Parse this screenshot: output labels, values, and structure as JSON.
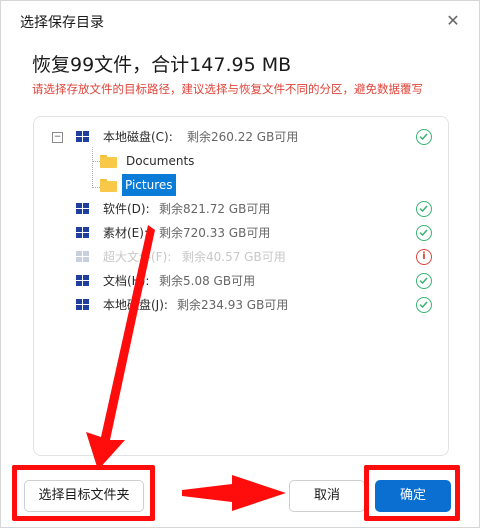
{
  "dialog": {
    "title": "选择保存目录",
    "headline": "恢复99文件，合计147.95 MB",
    "warning": "请选择存放文件的目标路径，建议选择与恢复文件不同的分区，避免数据覆写"
  },
  "tree": {
    "drives": [
      {
        "name": "本地磁盘(C):",
        "space": "剩余260.22 GB可用",
        "status": "ok",
        "expanded": true,
        "children": [
          {
            "name": "Documents"
          },
          {
            "name": "Pictures",
            "selected": true
          }
        ]
      },
      {
        "name": "软件(D):",
        "space": "剩余821.72 GB可用",
        "status": "ok"
      },
      {
        "name": "素材(E):",
        "space": "剩余720.33 GB可用",
        "status": "ok"
      },
      {
        "name": "超大文件(F):",
        "space": "剩余40.57 GB可用",
        "status": "error",
        "disabled": true
      },
      {
        "name": "文档(H):",
        "space": "剩余5.08 GB可用",
        "status": "ok"
      },
      {
        "name": "本地磁盘(J):",
        "space": "剩余234.93 GB可用",
        "status": "ok"
      }
    ]
  },
  "footer": {
    "choose_folder": "选择目标文件夹",
    "cancel": "取消",
    "confirm": "确定"
  },
  "colors": {
    "accent": "#0a6fd0",
    "annotation": "#ff0d0d",
    "ok": "#3cb371",
    "warning": "#e0443a"
  }
}
